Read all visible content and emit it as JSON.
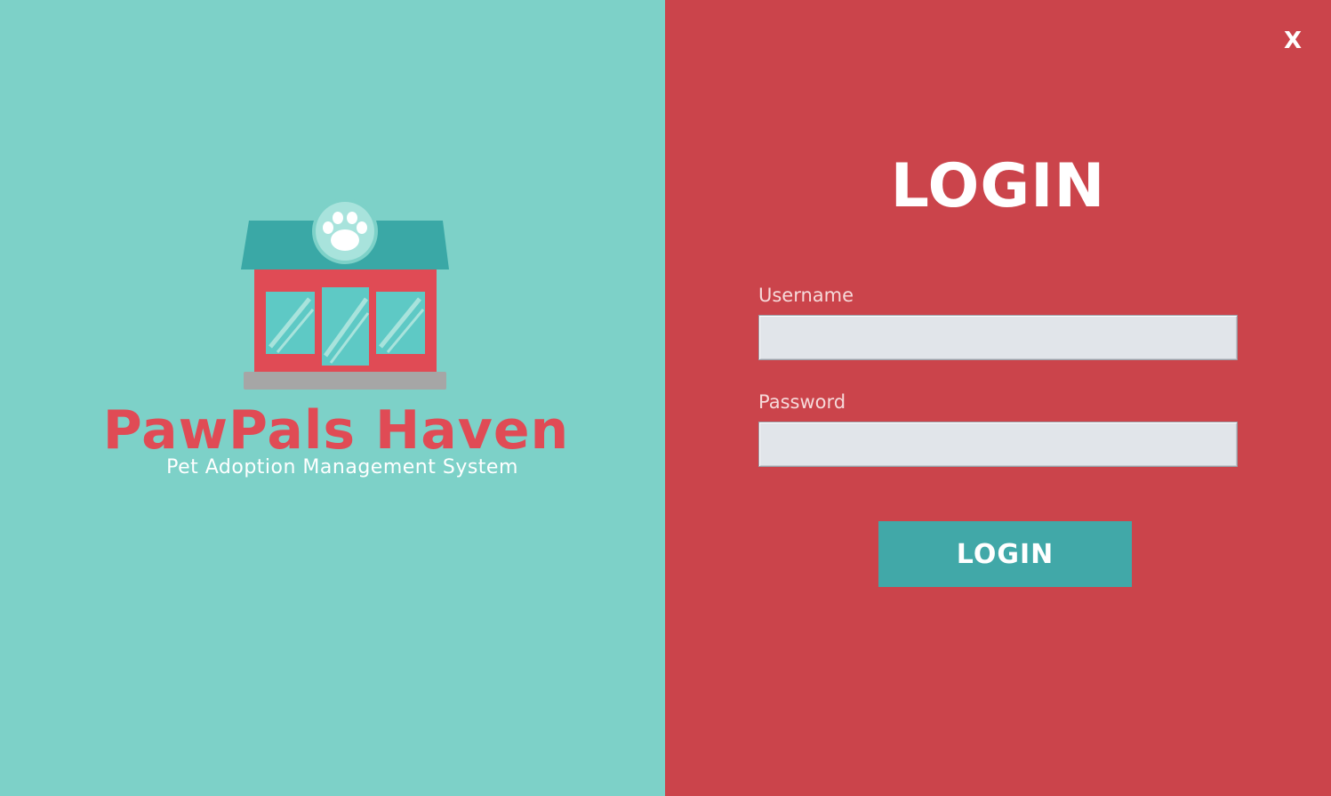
{
  "brand": {
    "name": "PawPals Haven",
    "tagline": "Pet Adoption Management System"
  },
  "login": {
    "title": "LOGIN",
    "close_label": "X",
    "username_label": "Username",
    "username_value": "",
    "password_label": "Password",
    "password_value": "",
    "button_label": "LOGIN"
  },
  "colors": {
    "left_panel_bg": "#7dd1c8",
    "right_panel_bg": "#cb444b",
    "brand_red": "#e04b55",
    "button_teal": "#41a8a8",
    "input_bg": "#e1e5ea"
  },
  "icons": {
    "logo": "pet-shop-icon",
    "paw": "paw-icon",
    "close": "close-icon"
  }
}
